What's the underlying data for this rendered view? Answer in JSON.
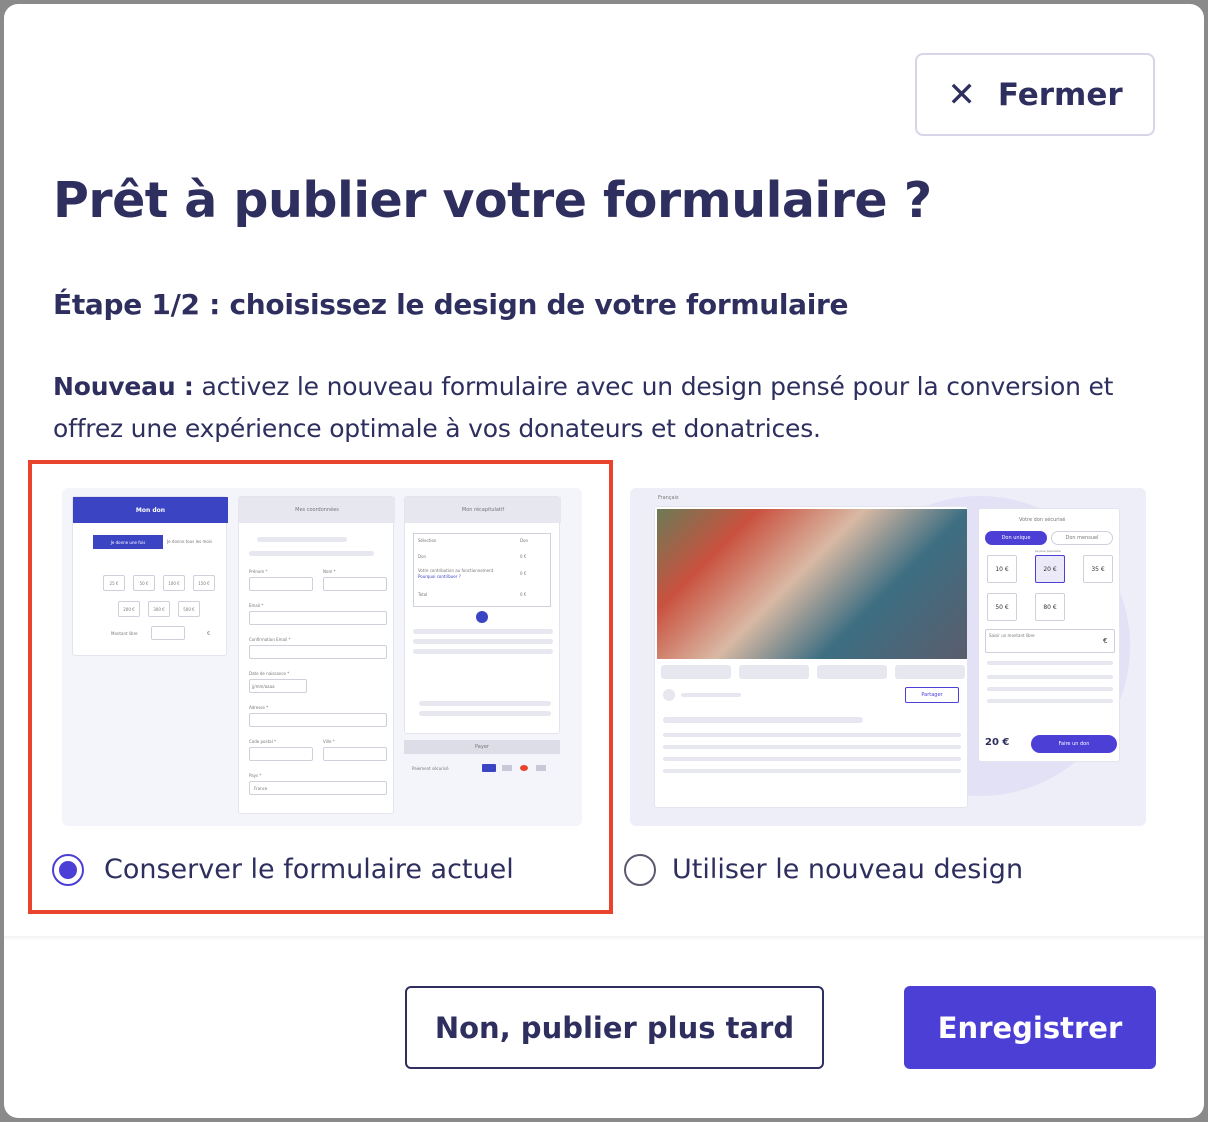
{
  "modal": {
    "close_label": "Fermer",
    "close_icon": "close-icon",
    "title": "Prêt à publier votre formulaire ?",
    "step": "Étape 1/2 : choisissez le design de votre formulaire",
    "desc_strong": "Nouveau :",
    "desc_text": " activez le nouveau formulaire avec un design pensé pour la conversion et offrez une expérience optimale à vos donateurs et donatrices.",
    "options": [
      {
        "label": "Conserver le formulaire actuel",
        "selected": true
      },
      {
        "label": "Utiliser le nouveau design",
        "selected": false
      }
    ],
    "later_label": "Non, publier plus tard",
    "save_label": "Enregistrer"
  },
  "colors": {
    "primary": "#4b3fd6",
    "text": "#2e2f5e",
    "highlight": "#e8432c"
  },
  "preview_current": {
    "tab1": "Mon don",
    "tab2": "Mes coordonnées",
    "tab3": "Mon récapitulatif",
    "once": "Je donne une fois",
    "monthly": "Je donne tous les mois",
    "amounts": [
      "25 €",
      "50 €",
      "100 €",
      "150 €",
      "200 €",
      "300 €",
      "500 €"
    ],
    "free_amount": "Montant libre",
    "currency": "€",
    "fields": [
      "Prénom *",
      "Nom *",
      "Email *",
      "Confirmation Email *",
      "Date de naissance *",
      "Adresse *",
      "Code postal *",
      "Ville *",
      "Pays *"
    ],
    "date_placeholder": "jj/mm/aaaa",
    "country_value": "France",
    "recap_rows": [
      [
        "Sélection",
        "Don"
      ],
      [
        "Don",
        "0 €"
      ],
      [
        "Votre contribution au fonctionnement",
        "0 €"
      ],
      [
        "Total",
        "0 €"
      ]
    ],
    "recap_link": "Pourquoi contribuer ?",
    "pay_btn": "Payer",
    "secure": "Paiement sécurisé"
  },
  "preview_new": {
    "language": "Français",
    "secure_title": "Votre don sécurisé",
    "once": "Don unique",
    "monthly": "Don mensuel",
    "amounts": [
      "10 €",
      "20 €",
      "35 €",
      "50 €",
      "80 €"
    ],
    "popular": "Le plus populaire",
    "free_amount": "Saisir un montant libre",
    "currency": "€",
    "share": "Partager",
    "total": "20 €",
    "cta": "Faire un don"
  }
}
